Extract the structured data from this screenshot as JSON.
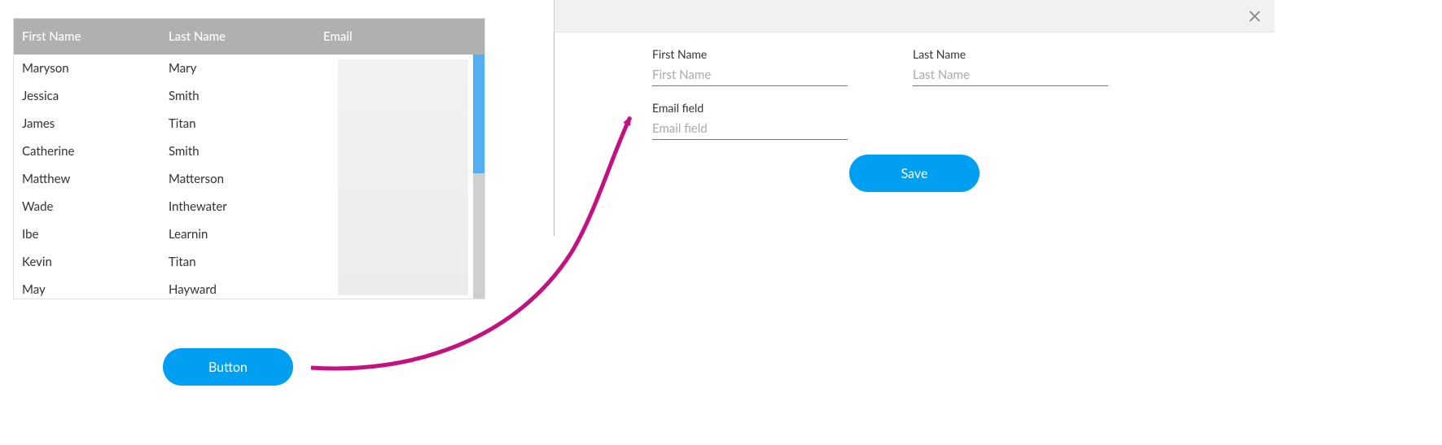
{
  "table": {
    "headers": {
      "first_name": "First Name",
      "last_name": "Last Name",
      "email": "Email"
    },
    "rows": [
      {
        "first": "Maryson",
        "last": "Mary",
        "email": ""
      },
      {
        "first": "Jessica",
        "last": "Smith",
        "email": ""
      },
      {
        "first": "James",
        "last": "Titan",
        "email": ""
      },
      {
        "first": "Catherine",
        "last": "Smith",
        "email": ""
      },
      {
        "first": "Matthew",
        "last": "Matterson",
        "email": ""
      },
      {
        "first": "Wade",
        "last": "Inthewater",
        "email": ""
      },
      {
        "first": "Ibe",
        "last": "Learnin",
        "email": ""
      },
      {
        "first": "Kevin",
        "last": "Titan",
        "email": ""
      },
      {
        "first": "May",
        "last": "Hayward",
        "email": ""
      }
    ]
  },
  "main_button": {
    "label": "Button"
  },
  "form": {
    "fields": {
      "first_name": {
        "label": "First Name",
        "placeholder": "First Name",
        "value": ""
      },
      "last_name": {
        "label": "Last Name",
        "placeholder": "Last Name",
        "value": ""
      },
      "email": {
        "label": "Email field",
        "placeholder": "Email field",
        "value": ""
      }
    },
    "save_label": "Save"
  },
  "colors": {
    "accent": "#009ff2",
    "arrow": "#c3127f"
  }
}
